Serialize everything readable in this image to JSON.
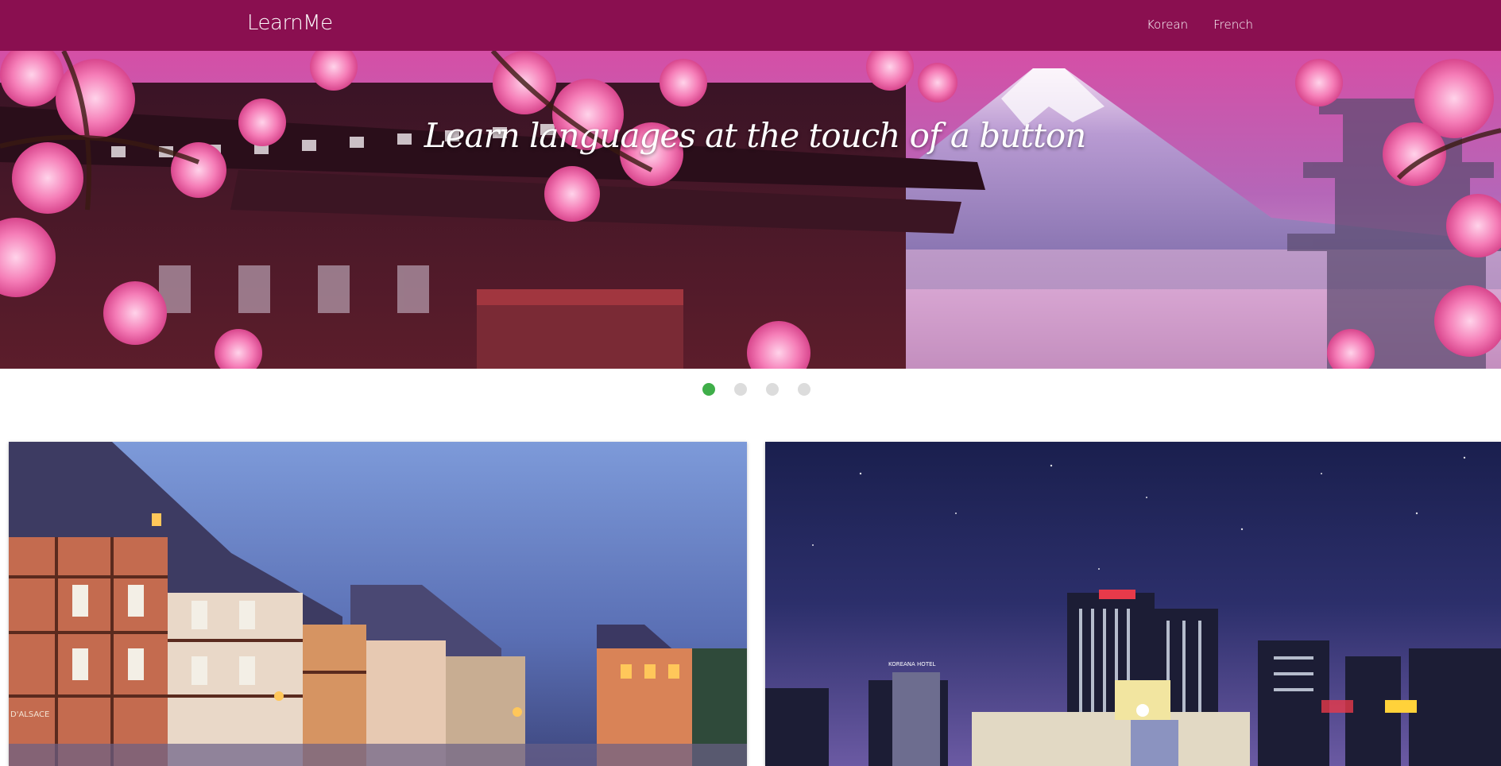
{
  "navbar": {
    "brand": "LearnMe",
    "links": [
      {
        "label": "Korean"
      },
      {
        "label": "French"
      }
    ],
    "color": "#8a0f50"
  },
  "hero": {
    "title": "Learn languages at the touch of a button"
  },
  "carousel": {
    "slide_count": 4,
    "active_index": 0,
    "active_color": "#3fae49",
    "inactive_color": "#dcdcdc"
  },
  "cards": [
    {
      "image_label": "D'ALSACE"
    },
    {
      "image_label": "KOREANA HOTEL"
    }
  ]
}
